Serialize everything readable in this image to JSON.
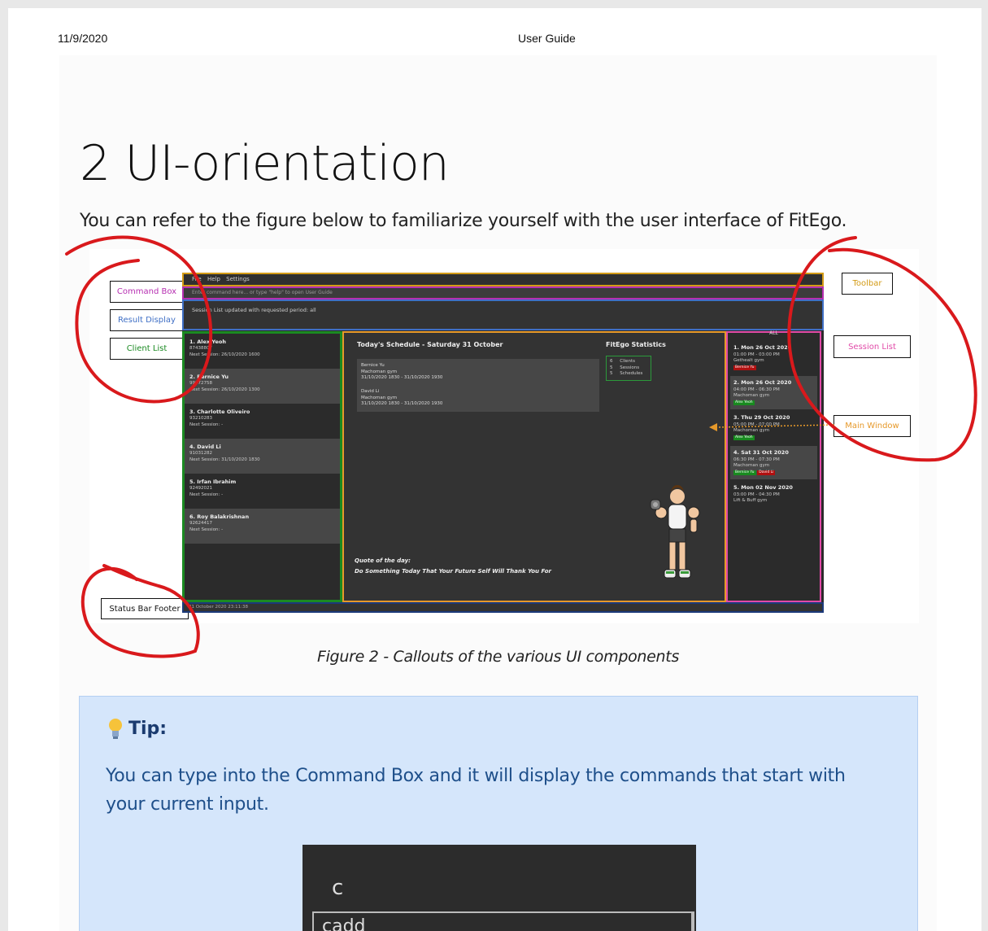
{
  "header": {
    "date": "11/9/2020",
    "title": "User Guide"
  },
  "section": {
    "heading": "2 UI-orientation",
    "intro": "You can refer to the figure below to familiarize yourself with the user interface of FitEgo."
  },
  "callouts": {
    "command_box": "Command Box",
    "result_display": "Result Display",
    "client_list": "Client List",
    "status_bar_footer": "Status Bar Footer",
    "toolbar": "Toolbar",
    "session_list": "Session List",
    "main_window": "Main Window"
  },
  "app": {
    "menu": "File  Help  Settings",
    "command_placeholder": "Enter command here... or type \"help\" to open User Guide",
    "result_text": "Session List updated with requested period: all",
    "clients": [
      {
        "name": "1.  Alex Yeoh",
        "phone": "87438807",
        "next": "Next Session: 26/10/2020 1600"
      },
      {
        "name": "2.  Bernice Yu",
        "phone": "99272758",
        "next": "Next Session: 26/10/2020 1300"
      },
      {
        "name": "3.  Charlotte Oliveiro",
        "phone": "93210283",
        "next": "Next Session:  -"
      },
      {
        "name": "4.  David Li",
        "phone": "91031282",
        "next": "Next Session: 31/10/2020 1830"
      },
      {
        "name": "5.  Irfan Ibrahim",
        "phone": "92492021",
        "next": "Next Session:  -"
      },
      {
        "name": "6.  Roy Balakrishnan",
        "phone": "92624417",
        "next": "Next Session:  -"
      }
    ],
    "schedule_title": "Today's Schedule - Saturday 31 October",
    "schedules": [
      {
        "client": "Bernice Yu",
        "gym": "Machoman gym",
        "time": "31/10/2020 1830 - 31/10/2020 1930"
      },
      {
        "client": "David Li",
        "gym": "Machoman gym",
        "time": "31/10/2020 1830 - 31/10/2020 1930"
      }
    ],
    "stats_title": "FitEgo Statistics",
    "stats": [
      {
        "count": "6",
        "label": "Clients"
      },
      {
        "count": "5",
        "label": "Sessions"
      },
      {
        "count": "5",
        "label": "Schedules"
      }
    ],
    "quote_label": "Quote of the day:",
    "quote": "Do Something Today That Your Future Self Will Thank You For",
    "sessions_filter": "ALL",
    "sessions": [
      {
        "title": "1.  Mon 26 Oct 2020",
        "time": "01:00 PM - 03:00 PM",
        "gym": "Gethealt gym",
        "tag": "Bernice Yu",
        "tag_color": "red"
      },
      {
        "title": "2.  Mon 26 Oct 2020",
        "time": "04:00 PM - 06:30 PM",
        "gym": "Machoman gym",
        "tag": "Alex Yeoh",
        "tag_color": "green"
      },
      {
        "title": "3.  Thu 29 Oct 2020",
        "time": "05:00 PM - 07:00 PM",
        "gym": "Machoman gym",
        "tag": "Alex Yeoh",
        "tag_color": "green"
      },
      {
        "title": "4.  Sat 31 Oct 2020",
        "time": "06:30 PM - 07:30 PM",
        "gym": "Machoman gym",
        "tag": "Bernice Yu",
        "tag2": "David Li",
        "tag_color": "green"
      },
      {
        "title": "5.  Mon 02 Nov 2020",
        "time": "03:00 PM - 04:30 PM",
        "gym": "Lift & Buff gym",
        "tag": "",
        "tag_color": ""
      }
    ],
    "footer": "31 October 2020 23:11:38"
  },
  "figure_caption": "Figure 2 - Callouts of the various UI components",
  "tip": {
    "label": "Tip:",
    "icon": "lightbulb-icon",
    "body": "You can type into the Command Box and it will display the commands that start with your current input.",
    "screenshot_input": "c",
    "screenshot_suggestion": "cadd"
  },
  "colors": {
    "toolbar_border": "#d39b16",
    "command_border": "#b62fb1",
    "result_border": "#3f6fc5",
    "client_border": "#1b8a22",
    "main_border": "#e6992a",
    "session_border": "#e14aa8",
    "footer_border": "#1c3a7a",
    "scribble": "#d9191c",
    "tip_bg": "#d5e6fb"
  }
}
